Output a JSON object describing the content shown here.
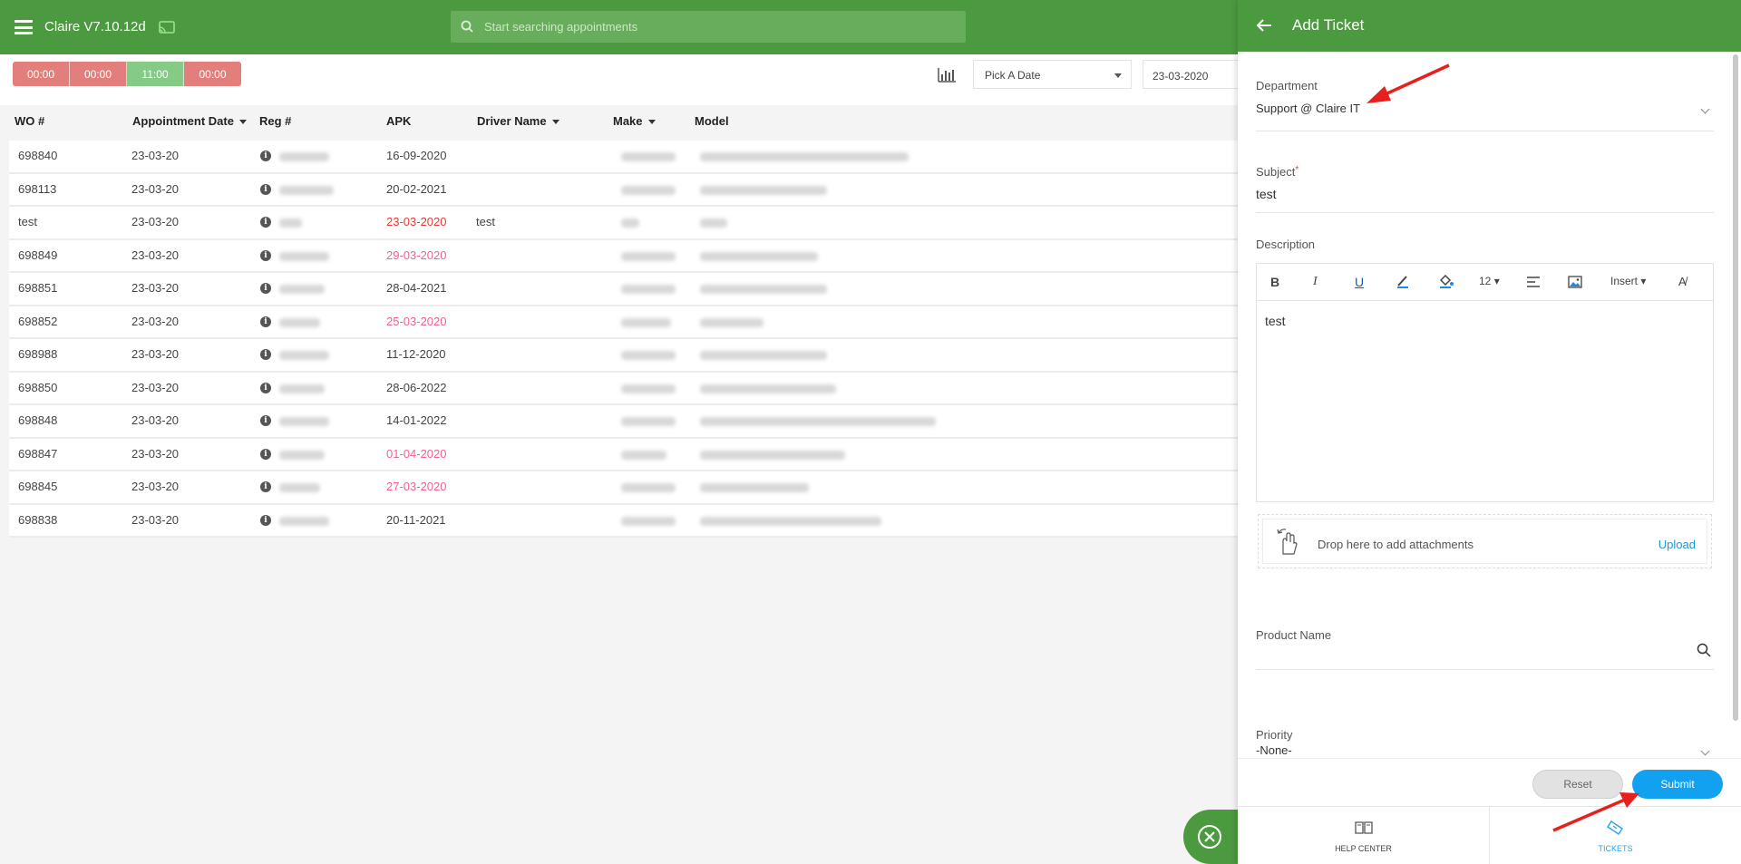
{
  "app": {
    "title": "Claire V7.10.12d",
    "search_placeholder": "Start searching appointments"
  },
  "controls": {
    "time_slots": [
      {
        "label": "00:00",
        "color": "#d9534f"
      },
      {
        "label": "00:00",
        "color": "#d9534f"
      },
      {
        "label": "11:00",
        "color": "#5cb85c"
      },
      {
        "label": "00:00",
        "color": "#d9534f"
      }
    ],
    "pick_date_label": "Pick A Date",
    "date_value": "23-03-2020"
  },
  "table": {
    "columns": [
      "WO #",
      "Appointment Date",
      "Reg #",
      "APK",
      "Driver Name",
      "Make",
      "Model"
    ],
    "rows": [
      {
        "wo": "698840",
        "date": "23-03-20",
        "apk": "16-09-2020",
        "apk_status": "normal",
        "driver": ""
      },
      {
        "wo": "698113",
        "date": "23-03-20",
        "apk": "20-02-2021",
        "apk_status": "normal",
        "driver": ""
      },
      {
        "wo": "test",
        "date": "23-03-20",
        "apk": "23-03-2020",
        "apk_status": "expired",
        "driver": "test"
      },
      {
        "wo": "698849",
        "date": "23-03-20",
        "apk": "29-03-2020",
        "apk_status": "soon",
        "driver": ""
      },
      {
        "wo": "698851",
        "date": "23-03-20",
        "apk": "28-04-2021",
        "apk_status": "normal",
        "driver": ""
      },
      {
        "wo": "698852",
        "date": "23-03-20",
        "apk": "25-03-2020",
        "apk_status": "soon",
        "driver": ""
      },
      {
        "wo": "698988",
        "date": "23-03-20",
        "apk": "11-12-2020",
        "apk_status": "normal",
        "driver": ""
      },
      {
        "wo": "698850",
        "date": "23-03-20",
        "apk": "28-06-2022",
        "apk_status": "normal",
        "driver": ""
      },
      {
        "wo": "698848",
        "date": "23-03-20",
        "apk": "14-01-2022",
        "apk_status": "normal",
        "driver": ""
      },
      {
        "wo": "698847",
        "date": "23-03-20",
        "apk": "01-04-2020",
        "apk_status": "soon",
        "driver": ""
      },
      {
        "wo": "698845",
        "date": "23-03-20",
        "apk": "27-03-2020",
        "apk_status": "soon",
        "driver": ""
      },
      {
        "wo": "698838",
        "date": "23-03-20",
        "apk": "20-11-2021",
        "apk_status": "normal",
        "driver": ""
      }
    ],
    "apk_colors": {
      "normal": "#444444",
      "expired": "#e53935",
      "soon": "#f06292"
    }
  },
  "panel": {
    "title": "Add Ticket",
    "department_label": "Department",
    "department_value": "Support @ Claire IT",
    "subject_label": "Subject",
    "subject_required": "*",
    "subject_value": "test",
    "description_label": "Description",
    "toolbar": {
      "bold": "B",
      "italic": "I",
      "underline": "U",
      "font_size": "12",
      "insert": "Insert"
    },
    "description_value": "test",
    "attach_text": "Drop here to add attachments",
    "upload_label": "Upload",
    "product_label": "Product Name",
    "priority_label": "Priority",
    "priority_value": "-None-",
    "reset_label": "Reset",
    "submit_label": "Submit",
    "nav": {
      "help_center": "HELP CENTER",
      "tickets": "TICKETS"
    }
  },
  "colors": {
    "brand_green": "#4c9a3f",
    "accent_blue": "#12a0f0",
    "annotation_red": "#e8201c"
  }
}
